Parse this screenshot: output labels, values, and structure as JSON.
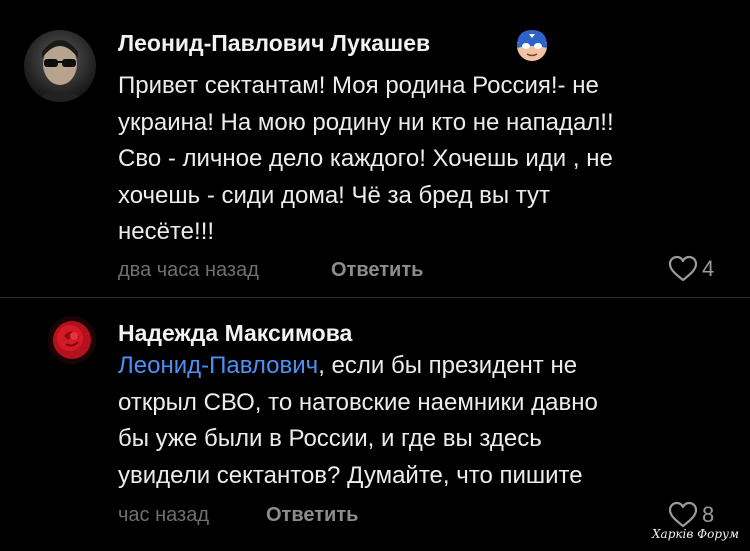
{
  "comments": [
    {
      "author": "Леонид-Павлович Лукашев",
      "badge_icon": "superhero-mask-emoji",
      "avatar_icon": "user-avatar-sunglasses",
      "lines": [
        "Привет сектантам! Моя родина Россия!- не",
        "украина! На мою родину ни кто не нападал!!",
        "Сво - личное дело каждого! Хочешь иди , не",
        "хочешь - сиди дома! Чё за бред вы тут",
        "несёте!!!"
      ],
      "time": "два часа назад",
      "reply_label": "Ответить",
      "like_count": "4",
      "like_icon": "heart-outline-icon"
    },
    {
      "author": "Надежда Максимова",
      "avatar_icon": "user-avatar-red-rose",
      "mention": "Леонид-Павлович",
      "lines": [
        ", если бы президент не",
        "открыл СВО, то натовские наемники давно",
        "бы уже были в России, и где вы здесь",
        "увидели сектантов? Думайте, что пишите"
      ],
      "time": "час назад",
      "reply_label": "Ответить",
      "like_count": "8",
      "like_icon": "heart-outline-icon"
    }
  ],
  "watermark": "Харків Форум",
  "colors": {
    "background": "#000000",
    "text": "#ececec",
    "mention": "#4e8ff5",
    "meta": "#6f6f6f",
    "reply": "#8c8c8c"
  }
}
